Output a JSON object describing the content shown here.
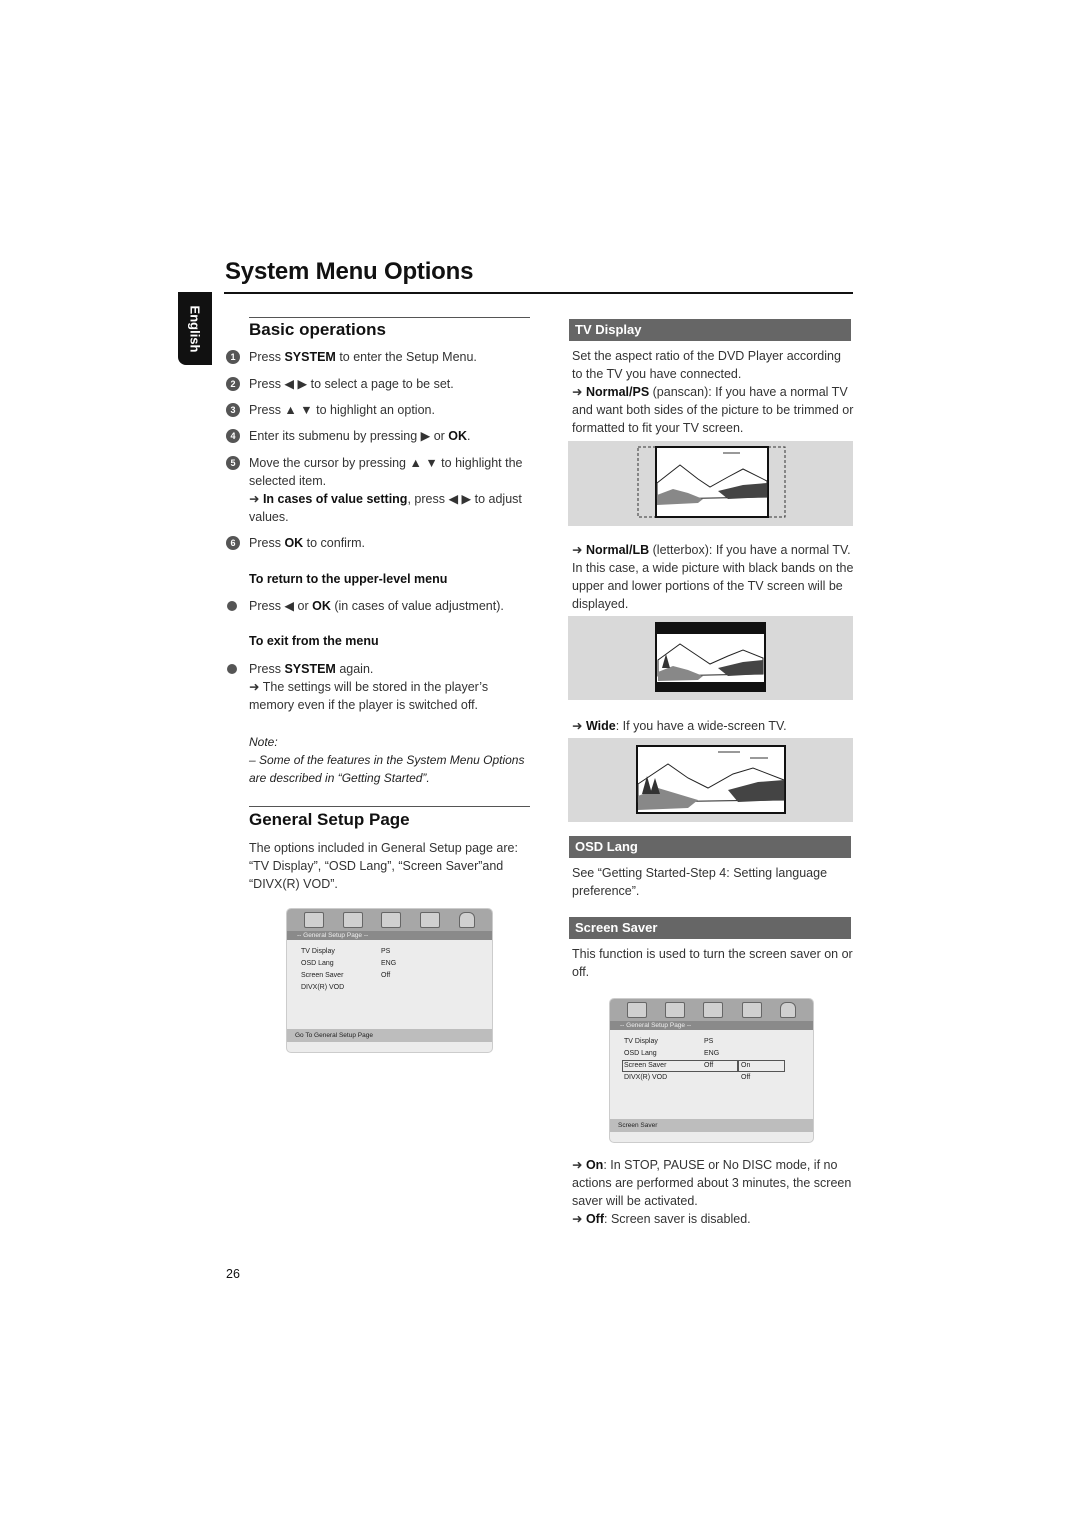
{
  "page": {
    "title": "System Menu Options",
    "language_tab": "English",
    "page_number": "26"
  },
  "basic_operations": {
    "heading": "Basic operations",
    "steps": [
      {
        "num": "1",
        "pre": "Press ",
        "bold": "SYSTEM",
        "post": " to enter the Setup Menu."
      },
      {
        "num": "2",
        "pre": "Press ◀ ▶  to select a page to be set.",
        "bold": "",
        "post": ""
      },
      {
        "num": "3",
        "pre": "Press ▲ ▼  to highlight an option.",
        "bold": "",
        "post": ""
      },
      {
        "num": "4",
        "pre": "Enter its submenu by pressing ▶  or ",
        "bold": "OK",
        "post": "."
      },
      {
        "num": "5",
        "pre": "Move the cursor by pressing ▲ ▼  to highlight the selected item.",
        "bold": "",
        "post": "",
        "arrow_bold": "In cases of value setting",
        "arrow_post": ", press ◀ ▶  to adjust values."
      },
      {
        "num": "6",
        "pre": "Press ",
        "bold": "OK",
        "post": " to confirm."
      }
    ],
    "return_heading": "To return to the upper-level menu",
    "return_bullet": {
      "pre": "Press ◀  or ",
      "bold": "OK",
      "post": " (in cases of value adjustment)."
    },
    "exit_heading": "To exit from the menu",
    "exit_bullet": {
      "pre": "Press ",
      "bold": "SYSTEM",
      "post": " again."
    },
    "exit_arrow": "The settings will be stored in the player’s memory even if the player is switched off.",
    "note_label": "Note:",
    "note_text": "–  Some of the features in the System Menu Options are described in “Getting Started”."
  },
  "general_setup": {
    "heading": "General Setup Page",
    "intro": "The options included in General Setup page are: “TV Display”, “OSD Lang”, “Screen Saver”and “DIVX(R) VOD”.",
    "osd_menu": {
      "page_label": "-- General Setup Page --",
      "icons": [
        "general-setup-icon",
        "audio-setup-icon",
        "video-setup-icon",
        "preference-icon",
        "password-lock-icon"
      ],
      "rows": [
        {
          "label": "TV Display",
          "value": "PS"
        },
        {
          "label": "OSD Lang",
          "value": "ENG"
        },
        {
          "label": "Screen Saver",
          "value": "Off"
        },
        {
          "label": "DIVX(R) VOD",
          "value": ""
        }
      ],
      "footer": "Go To General Setup Page"
    }
  },
  "tv_display": {
    "heading": "TV Display",
    "intro": "Set the aspect ratio of the DVD Player according to the TV you have connected.",
    "normal_ps": {
      "bold": "Normal/PS",
      "text": " (panscan): If you have a normal TV and want both sides of the picture to be trimmed or formatted to fit your TV screen."
    },
    "normal_lb": {
      "bold": "Normal/LB",
      "text": " (letterbox): If you have a normal TV. In this case, a wide picture with black bands on the upper and lower portions of the TV screen will be displayed."
    },
    "wide": {
      "bold": "Wide",
      "text": ": If you have a wide-screen TV."
    }
  },
  "osd_lang": {
    "heading": "OSD Lang",
    "text": "See “Getting Started-Step 4: Setting language preference”."
  },
  "screen_saver": {
    "heading": "Screen Saver",
    "text": "This function is used to turn the screen saver on or off.",
    "osd_menu": {
      "page_label": "-- General Setup Page --",
      "rows": [
        {
          "label": "TV Display",
          "value": "PS",
          "option": ""
        },
        {
          "label": "OSD Lang",
          "value": "ENG",
          "option": ""
        },
        {
          "label": "Screen Saver",
          "value": "Off",
          "option": "On"
        },
        {
          "label": "DIVX(R) VOD",
          "value": "",
          "option": "Off"
        }
      ],
      "footer": "Screen Saver"
    },
    "on": {
      "bold": "On",
      "text": ": In STOP, PAUSE or No DISC mode, if no actions are performed about 3 minutes, the screen saver will be activated."
    },
    "off": {
      "bold": "Off",
      "text": ": Screen saver is disabled."
    }
  },
  "colors": {
    "section_bar": "#666666",
    "illustration_bg": "#d9d9d9",
    "text": "#333333"
  }
}
